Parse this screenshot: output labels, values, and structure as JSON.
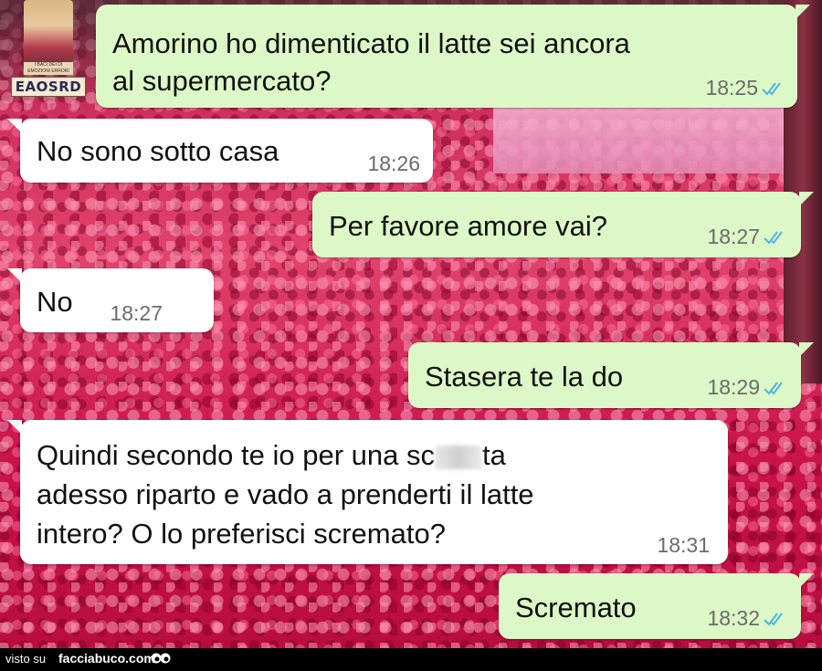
{
  "watermark": {
    "logo_label": "EAOSRD",
    "logo_caption": "I BACI DEI DI EMOZIONI ERRORI"
  },
  "messages": [
    {
      "id": "m1",
      "direction": "outgoing",
      "lines": [
        "Amorino ho dimenticato il latte sei ancora",
        "al supermercato?"
      ],
      "time": "18:25",
      "read": true
    },
    {
      "id": "m2",
      "direction": "incoming",
      "lines": [
        "No sono sotto casa"
      ],
      "time": "18:26"
    },
    {
      "id": "m3",
      "direction": "outgoing",
      "lines": [
        "Per favore amore vai?"
      ],
      "time": "18:27",
      "read": true
    },
    {
      "id": "m4",
      "direction": "incoming",
      "lines": [
        "No"
      ],
      "time": "18:27"
    },
    {
      "id": "m5",
      "direction": "outgoing",
      "lines": [
        "Stasera te la do"
      ],
      "time": "18:29",
      "read": true
    },
    {
      "id": "m6",
      "direction": "incoming",
      "line1_start": "Quindi secondo te io per una sc",
      "line1_end": "ta",
      "lines_rest": [
        "adesso riparto e vado a prenderti il latte",
        "intero? O lo preferisci scremato?"
      ],
      "time": "18:31"
    },
    {
      "id": "m7",
      "direction": "outgoing",
      "lines": [
        "Scremato"
      ],
      "time": "18:32",
      "read": true
    }
  ],
  "footer": {
    "visto_su": "visto su",
    "site": "facciabuco.com"
  },
  "colors": {
    "outgoing_bubble": "#dcf8c6",
    "incoming_bubble": "#ffffff",
    "timestamp": "#6b6b6b",
    "read_ticks": "#4fb3e8"
  },
  "icons": {
    "read_receipt": "double-check-icon",
    "footer_logo": "eyes-icon"
  }
}
